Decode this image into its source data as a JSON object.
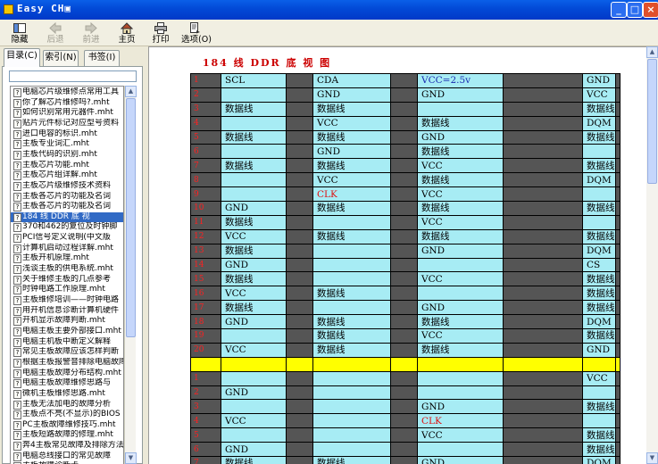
{
  "window": {
    "title": "Easy CH▣",
    "buttons": [
      "_",
      "□",
      "×"
    ]
  },
  "toolbar": [
    {
      "label": "隐藏",
      "icon": "hide-icon",
      "enabled": true
    },
    {
      "label": "后退",
      "icon": "back-arrow-icon",
      "enabled": false
    },
    {
      "label": "前进",
      "icon": "forward-arrow-icon",
      "enabled": false
    },
    {
      "label": "主页",
      "icon": "home-icon",
      "enabled": true
    },
    {
      "label": "打印",
      "icon": "print-icon",
      "enabled": true
    },
    {
      "label": "选项(O)",
      "icon": "options-icon",
      "enabled": true
    }
  ],
  "tabs": [
    "目录(C)",
    "索引(N)",
    "书签(I)"
  ],
  "toc_items": [
    "电脑芯片级维修点常用工具",
    "你了解芯片维修吗?.mht",
    "如何识别常用元器件.mht",
    "贴片元件标记对应型号资料",
    "进口电容的标识.mht",
    "主板专业词汇.mht",
    "主板代码的识别.mht",
    "主板芯片功能.mht",
    "主板芯片组详解.mht",
    "主板芯片级维修技术资料",
    "主板各芯片的功能及名词",
    "主板各芯片的功能及名词",
    "184 线  DDR 底 视",
    "370和462的复位及时钟脚",
    "PCI信号定义说明(中文版",
    "计算机启动过程详解.mht",
    "主板开机原理.mht",
    "浅谈主板的供电系统.mht",
    "关于维修主板的几点参考",
    "时钟电路工作原理.mht",
    "主板维修培训——时钟电路",
    "用开机信息诊断计算机硬件",
    "开机显示故障判断.mht",
    "电脑主板主要外部接口.mht",
    "电脑主机板中断定义解释",
    "常见主板故障应该怎样判断",
    "根据主板报警音排除电脑故障",
    "电脑主板故障分布结构.mht",
    "电脑主板故障维修思路与",
    "微机主板维修思路.mht",
    "主板无法加电的故障分析",
    "主板点不亮(不显示)的BIOS",
    "PC主板故障维修技巧.mht",
    "主板短路故障的修理.mht",
    "奔4主板常见故障及排除方法",
    "电脑总线接口的常见故障",
    "主板故障诊断卡"
  ],
  "selected_toc_index": 12,
  "document": {
    "title": "184 线  DDR 底 视 图",
    "rows": [
      {
        "pin": "1",
        "a": "SCL",
        "b": "CDA",
        "c": "VCC=2.5v",
        "d": "GND"
      },
      {
        "pin": "2",
        "a": "",
        "b": "GND",
        "c": "GND",
        "d": "VCC"
      },
      {
        "pin": "3",
        "a": "数据线",
        "b": "数据线",
        "c": "",
        "d": "数据线"
      },
      {
        "pin": "4",
        "a": "",
        "b": "VCC",
        "c": "数据线",
        "d": "DQM"
      },
      {
        "pin": "5",
        "a": "数据线",
        "b": "数据线",
        "c": "GND",
        "d": "数据线"
      },
      {
        "pin": "6",
        "a": "",
        "b": "GND",
        "c": "数据线",
        "d": ""
      },
      {
        "pin": "7",
        "a": "数据线",
        "b": "数据线",
        "c": "VCC",
        "d": "数据线"
      },
      {
        "pin": "8",
        "a": "",
        "b": "VCC",
        "c": "数据线",
        "d": "DQM"
      },
      {
        "pin": "9",
        "a": "",
        "b": "CLK",
        "c": "VCC",
        "d": ""
      },
      {
        "pin": "10",
        "a": "GND",
        "b": "数据线",
        "c": "数据线",
        "d": "数据线"
      },
      {
        "pin": "11",
        "a": "数据线",
        "b": "",
        "c": "VCC",
        "d": ""
      },
      {
        "pin": "12",
        "a": "VCC",
        "b": "数据线",
        "c": "数据线",
        "d": "数据线"
      },
      {
        "pin": "13",
        "a": "数据线",
        "b": "",
        "c": "GND",
        "d": "DQM"
      },
      {
        "pin": "14",
        "a": "GND",
        "b": "",
        "c": "",
        "d": "CS"
      },
      {
        "pin": "15",
        "a": "数据线",
        "b": "",
        "c": "VCC",
        "d": "数据线"
      },
      {
        "pin": "16",
        "a": "VCC",
        "b": "数据线",
        "c": "",
        "d": "数据线"
      },
      {
        "pin": "17",
        "a": "数据线",
        "b": "",
        "c": "GND",
        "d": "数据线"
      },
      {
        "pin": "18",
        "a": "GND",
        "b": "数据线",
        "c": "数据线",
        "d": "DQM"
      },
      {
        "pin": "19",
        "a": "",
        "b": "数据线",
        "c": "VCC",
        "d": "数据线"
      },
      {
        "pin": "20",
        "a": "VCC",
        "b": "数据线",
        "c": "数据线",
        "d": "GND"
      },
      {
        "pin": "",
        "a": "",
        "b": "",
        "c": "",
        "d": "",
        "highlight": true
      },
      {
        "pin": "1",
        "a": "",
        "b": "",
        "c": "",
        "d": "VCC"
      },
      {
        "pin": "2",
        "a": "GND",
        "b": "",
        "c": "",
        "d": ""
      },
      {
        "pin": "3",
        "a": "",
        "b": "",
        "c": "GND",
        "d": "数据线"
      },
      {
        "pin": "4",
        "a": "VCC",
        "b": "",
        "c": "CLK",
        "d": ""
      },
      {
        "pin": "5",
        "a": "",
        "b": "",
        "c": "VCC",
        "d": "数据线"
      },
      {
        "pin": "6",
        "a": "GND",
        "b": "",
        "c": "",
        "d": "数据线"
      },
      {
        "pin": "7",
        "a": "数据线",
        "b": "数据线",
        "c": "GND",
        "d": "DQM"
      }
    ],
    "colored_cells": {
      "0-c": "#1a2bb0",
      "8-b": "#e01010",
      "24-c": "#e01010"
    }
  },
  "colors": {
    "title_bar": "#0249d6",
    "table_cell": "#a7ecf4",
    "pin_cell": "#555555",
    "highlight_row": "#ffff00",
    "doc_title": "#cc0000"
  }
}
